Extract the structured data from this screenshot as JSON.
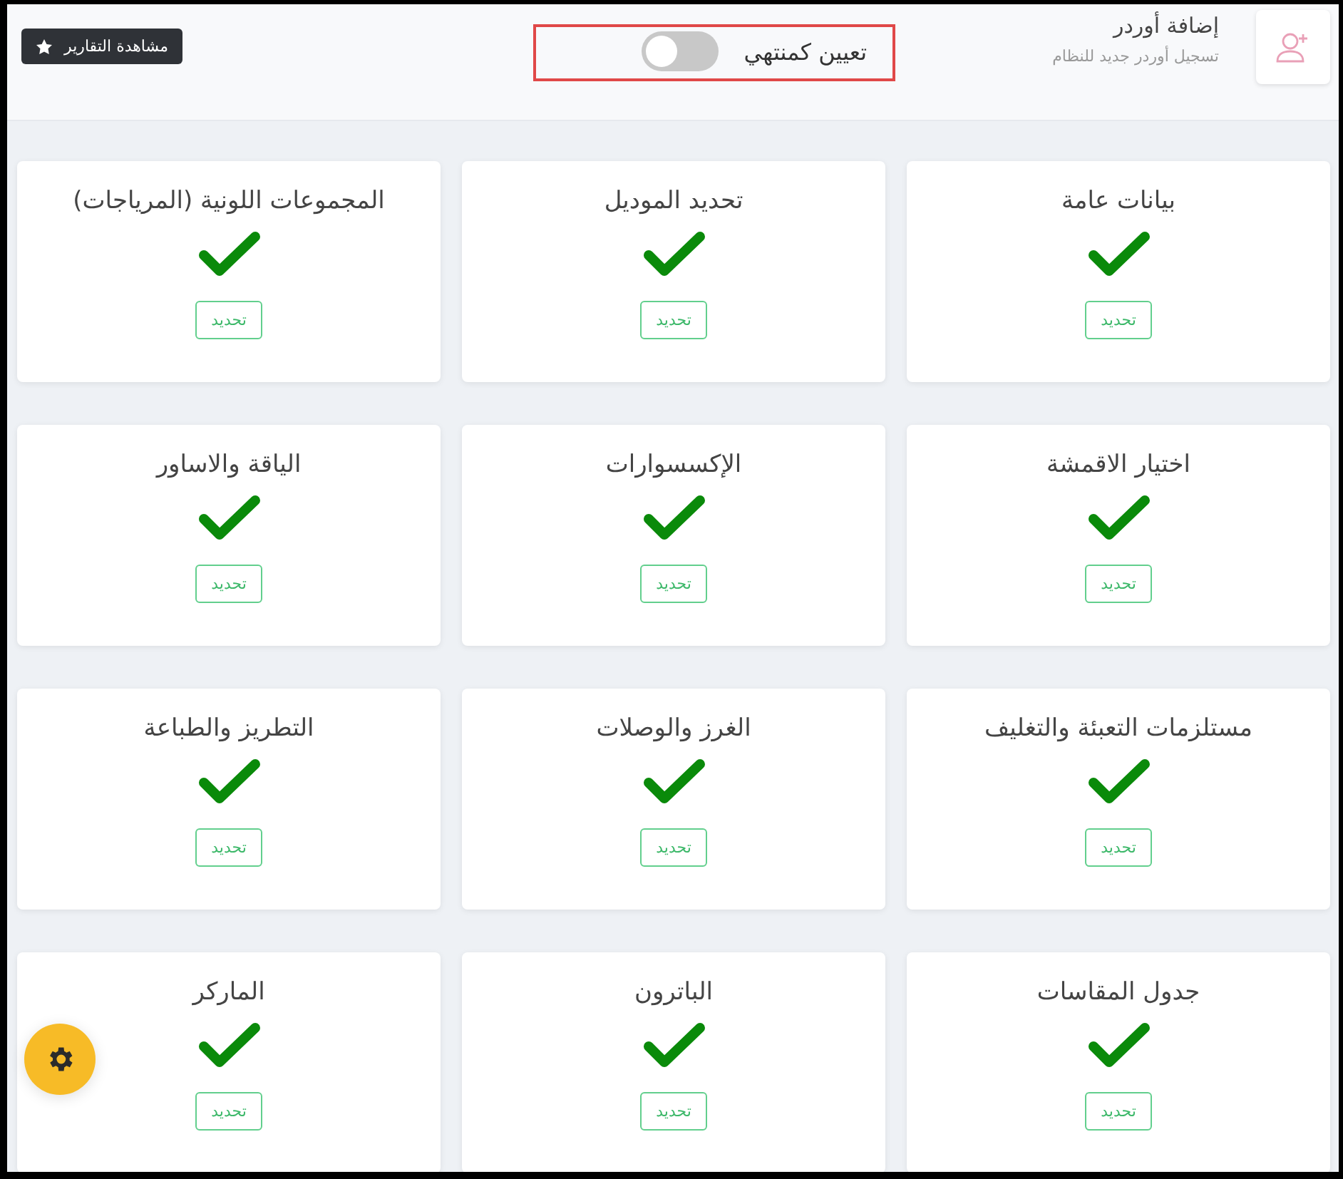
{
  "header": {
    "title": "إضافة أوردر",
    "subtitle": "تسجيل أوردر جديد للنظام",
    "toggle": {
      "label": "تعيين كمنتهي",
      "on": false
    },
    "reports_button": "مشاهدة التقارير"
  },
  "cards": [
    {
      "title": "بيانات عامة",
      "done": true,
      "button": "تحديد"
    },
    {
      "title": "تحديد الموديل",
      "done": true,
      "button": "تحديد"
    },
    {
      "title": "المجموعات اللونية (المرياجات)",
      "done": true,
      "button": "تحديد"
    },
    {
      "title": "اختيار الاقمشة",
      "done": true,
      "button": "تحديد"
    },
    {
      "title": "الإكسسوارات",
      "done": true,
      "button": "تحديد"
    },
    {
      "title": "الياقة والاساور",
      "done": true,
      "button": "تحديد"
    },
    {
      "title": "مستلزمات التعبئة والتغليف",
      "done": true,
      "button": "تحديد"
    },
    {
      "title": "الغرز والوصلات",
      "done": true,
      "button": "تحديد"
    },
    {
      "title": "التطريز والطباعة",
      "done": true,
      "button": "تحديد"
    },
    {
      "title": "جدول المقاسات",
      "done": true,
      "button": "تحديد"
    },
    {
      "title": "الباترون",
      "done": true,
      "button": "تحديد"
    },
    {
      "title": "الماركر",
      "done": true,
      "button": "تحديد"
    }
  ]
}
